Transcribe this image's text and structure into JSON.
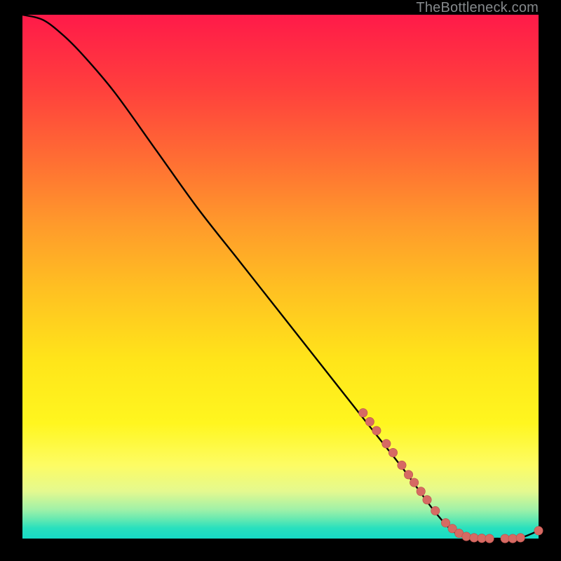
{
  "watermark": "TheBottleneck.com",
  "colors": {
    "page_bg": "#000000",
    "gradient_top": "#ff1a49",
    "gradient_bottom": "#17dbc6",
    "curve": "#000000",
    "marker_fill": "#d66a63",
    "marker_stroke": "#b94f4a"
  },
  "chart_data": {
    "type": "line",
    "title": "",
    "xlabel": "",
    "ylabel": "",
    "xlim": [
      0,
      100
    ],
    "ylim": [
      0,
      100
    ],
    "series": [
      {
        "name": "bottleneck-curve",
        "x": [
          0,
          4,
          8,
          12,
          18,
          26,
          34,
          42,
          50,
          58,
          66,
          74,
          80,
          84,
          88,
          92,
          96,
          100
        ],
        "y": [
          100,
          99,
          96,
          92,
          85,
          74,
          63,
          53,
          43,
          33,
          23,
          13,
          5,
          1,
          0,
          0,
          0,
          1.5
        ]
      }
    ],
    "markers": [
      {
        "x": 66.0,
        "y": 24.0
      },
      {
        "x": 67.3,
        "y": 22.3
      },
      {
        "x": 68.6,
        "y": 20.6
      },
      {
        "x": 70.5,
        "y": 18.1
      },
      {
        "x": 71.8,
        "y": 16.4
      },
      {
        "x": 73.5,
        "y": 14.0
      },
      {
        "x": 74.8,
        "y": 12.2
      },
      {
        "x": 75.9,
        "y": 10.7
      },
      {
        "x": 77.2,
        "y": 9.0
      },
      {
        "x": 78.4,
        "y": 7.4
      },
      {
        "x": 80.0,
        "y": 5.3
      },
      {
        "x": 82.0,
        "y": 3.0
      },
      {
        "x": 83.3,
        "y": 1.9
      },
      {
        "x": 84.6,
        "y": 1.0
      },
      {
        "x": 86.0,
        "y": 0.4
      },
      {
        "x": 87.5,
        "y": 0.15
      },
      {
        "x": 89.0,
        "y": 0.05
      },
      {
        "x": 90.5,
        "y": 0.0
      },
      {
        "x": 93.5,
        "y": 0.0
      },
      {
        "x": 95.0,
        "y": 0.0
      },
      {
        "x": 96.5,
        "y": 0.15
      },
      {
        "x": 100.0,
        "y": 1.5
      }
    ]
  }
}
